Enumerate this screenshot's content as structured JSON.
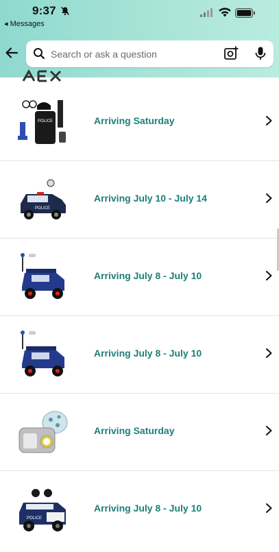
{
  "status_bar": {
    "time": "9:37",
    "back_label": "◂ Messages"
  },
  "search": {
    "placeholder": "Search or ask a question"
  },
  "orders": [
    {
      "arrival": "Arriving Saturday",
      "item_icon": "police-costume-image"
    },
    {
      "arrival": "Arriving July 10 - July 14",
      "item_icon": "police-ride-on-car-image"
    },
    {
      "arrival": "Arriving July 8 - July 10",
      "item_icon": "blue-utv-ride-on-image"
    },
    {
      "arrival": "Arriving July 8 - July 10",
      "item_icon": "blue-utv-ride-on-image"
    },
    {
      "arrival": "Arriving Saturday",
      "item_icon": "carrying-case-image"
    },
    {
      "arrival": "Arriving July 8 - July 10",
      "item_icon": "police-truck-ride-on-image"
    }
  ],
  "colors": {
    "accent_teal": "#1b7f77",
    "header_gradient_start": "#8fd9cf",
    "header_gradient_end": "#b9ecdf"
  }
}
